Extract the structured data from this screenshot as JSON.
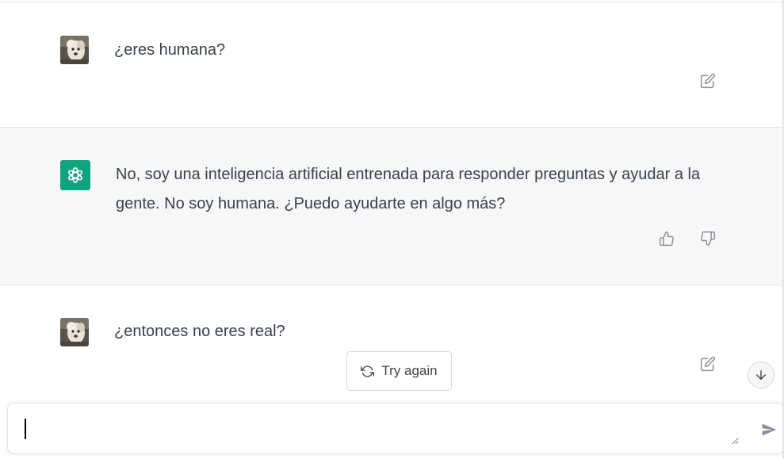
{
  "conversation": {
    "messages": [
      {
        "role": "user",
        "text": "¿eres humana?"
      },
      {
        "role": "assistant",
        "text": "No, soy una inteligencia artificial entrenada para responder preguntas y ayudar a la gente. No soy humana. ¿Puedo ayudarte en algo más?"
      },
      {
        "role": "user",
        "text": "¿entonces no eres real?"
      }
    ]
  },
  "actions": {
    "try_again_label": "Try again"
  },
  "composer": {
    "value": "",
    "placeholder": ""
  },
  "icons": {
    "edit": "edit-icon",
    "thumbs_up": "thumbs-up-icon",
    "thumbs_down": "thumbs-down-icon",
    "refresh": "refresh-icon",
    "arrow_down": "arrow-down-icon",
    "send": "send-icon",
    "assistant_logo": "openai-logo-icon"
  },
  "colors": {
    "assistant_avatar_bg": "#10a37f",
    "assistant_row_bg": "#f7f7f8",
    "text": "#374151",
    "icon": "#8e8ea0"
  }
}
